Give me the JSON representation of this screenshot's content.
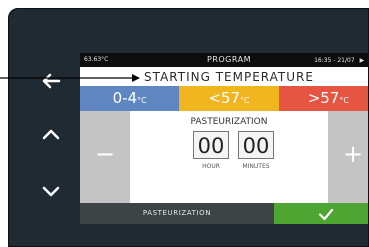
{
  "status": {
    "temperature": "63.63°C",
    "screen_title": "PROGRAM",
    "time_date": "16:35 - 21/07"
  },
  "heading": "STARTING TEMPERATURE",
  "tabs": [
    {
      "label": "0-4",
      "unit": "°C",
      "color": "#5f86c0"
    },
    {
      "label": "<57",
      "unit": "°C",
      "color": "#f0b51f"
    },
    {
      "label": ">57",
      "unit": "°C",
      "color": "#e65542"
    }
  ],
  "panel": {
    "title": "PASTEURIZATION",
    "hours": "00",
    "minutes": "00",
    "hour_label": "HOUR",
    "minutes_label": "MINUTES"
  },
  "buttons": {
    "minus": "−",
    "plus": "+"
  },
  "bottom": {
    "label": "PASTEURIZATION"
  },
  "icons": {
    "back": "arrow-left-icon",
    "up": "chevron-up-icon",
    "down": "chevron-down-icon",
    "ok": "checkmark-icon",
    "play": "play-icon",
    "gear": "gear-icon"
  },
  "colors": {
    "device": "#1f2a33",
    "side_buttons": "#c4c4c4",
    "bottom_bar": "#3d4446",
    "confirm": "#4fa532"
  }
}
